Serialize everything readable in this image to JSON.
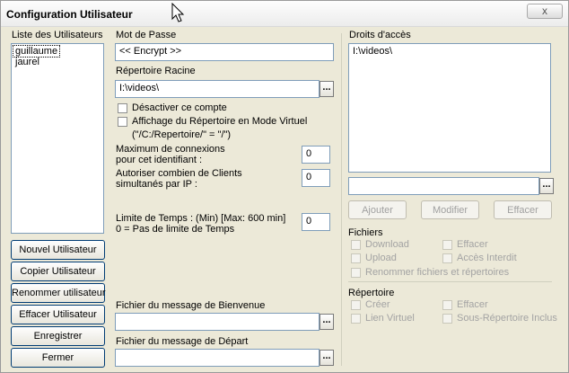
{
  "window": {
    "title": "Configuration Utilisateur",
    "close_glyph": "x"
  },
  "users": {
    "label": "Liste des Utilisateurs",
    "items": [
      "guillaume",
      "jaurel"
    ],
    "selected": "guillaume"
  },
  "user_buttons": {
    "new": "Nouvel Utilisateur",
    "copy": "Copier Utilisateur",
    "rename": "Renommer utilisateur",
    "delete": "Effacer Utilisateur",
    "save": "Enregistrer",
    "close": "Fermer"
  },
  "password": {
    "label": "Mot de Passe",
    "value": "<< Encrypt >>"
  },
  "root_dir": {
    "label": "Répertoire Racine",
    "value": "I:\\videos\\",
    "browse": "..."
  },
  "options": {
    "disable_account": "Désactiver ce compte",
    "virtual_mode": "Affichage du Répertoire en Mode Virtuel",
    "virtual_example": "(\"/C:/Repertoire/\" = \"/\")"
  },
  "max_connections": {
    "label_line1": "Maximum de connexions",
    "label_line2": "pour cet identifiant :",
    "value": "0"
  },
  "clients_per_ip": {
    "label_line1": "Autoriser combien de Clients",
    "label_line2": "simultanés par IP :",
    "value": "0"
  },
  "time_limit": {
    "label_line1": "Limite de Temps : (Min) [Max: 600 min]",
    "label_line2": "0 = Pas de limite de Temps",
    "value": "0"
  },
  "welcome_file": {
    "label": "Fichier du message de Bienvenue",
    "value": "",
    "browse": "..."
  },
  "departure_file": {
    "label": "Fichier du message de Départ",
    "value": "",
    "browse": "..."
  },
  "access_rights": {
    "label": "Droits d'accès",
    "items": [
      "I:\\videos\\"
    ],
    "path_value": "",
    "browse": "...",
    "add": "Ajouter",
    "modify": "Modifier",
    "delete": "Effacer"
  },
  "files": {
    "label": "Fichiers",
    "download": "Download",
    "delete": "Effacer",
    "upload": "Upload",
    "forbidden": "Accès Interdit",
    "rename": "Renommer fichiers et répertoires"
  },
  "directory": {
    "label": "Répertoire",
    "create": "Créer",
    "delete": "Effacer",
    "virtual_link": "Lien Virtuel",
    "subdirs": "Sous-Répertoire Inclus"
  }
}
